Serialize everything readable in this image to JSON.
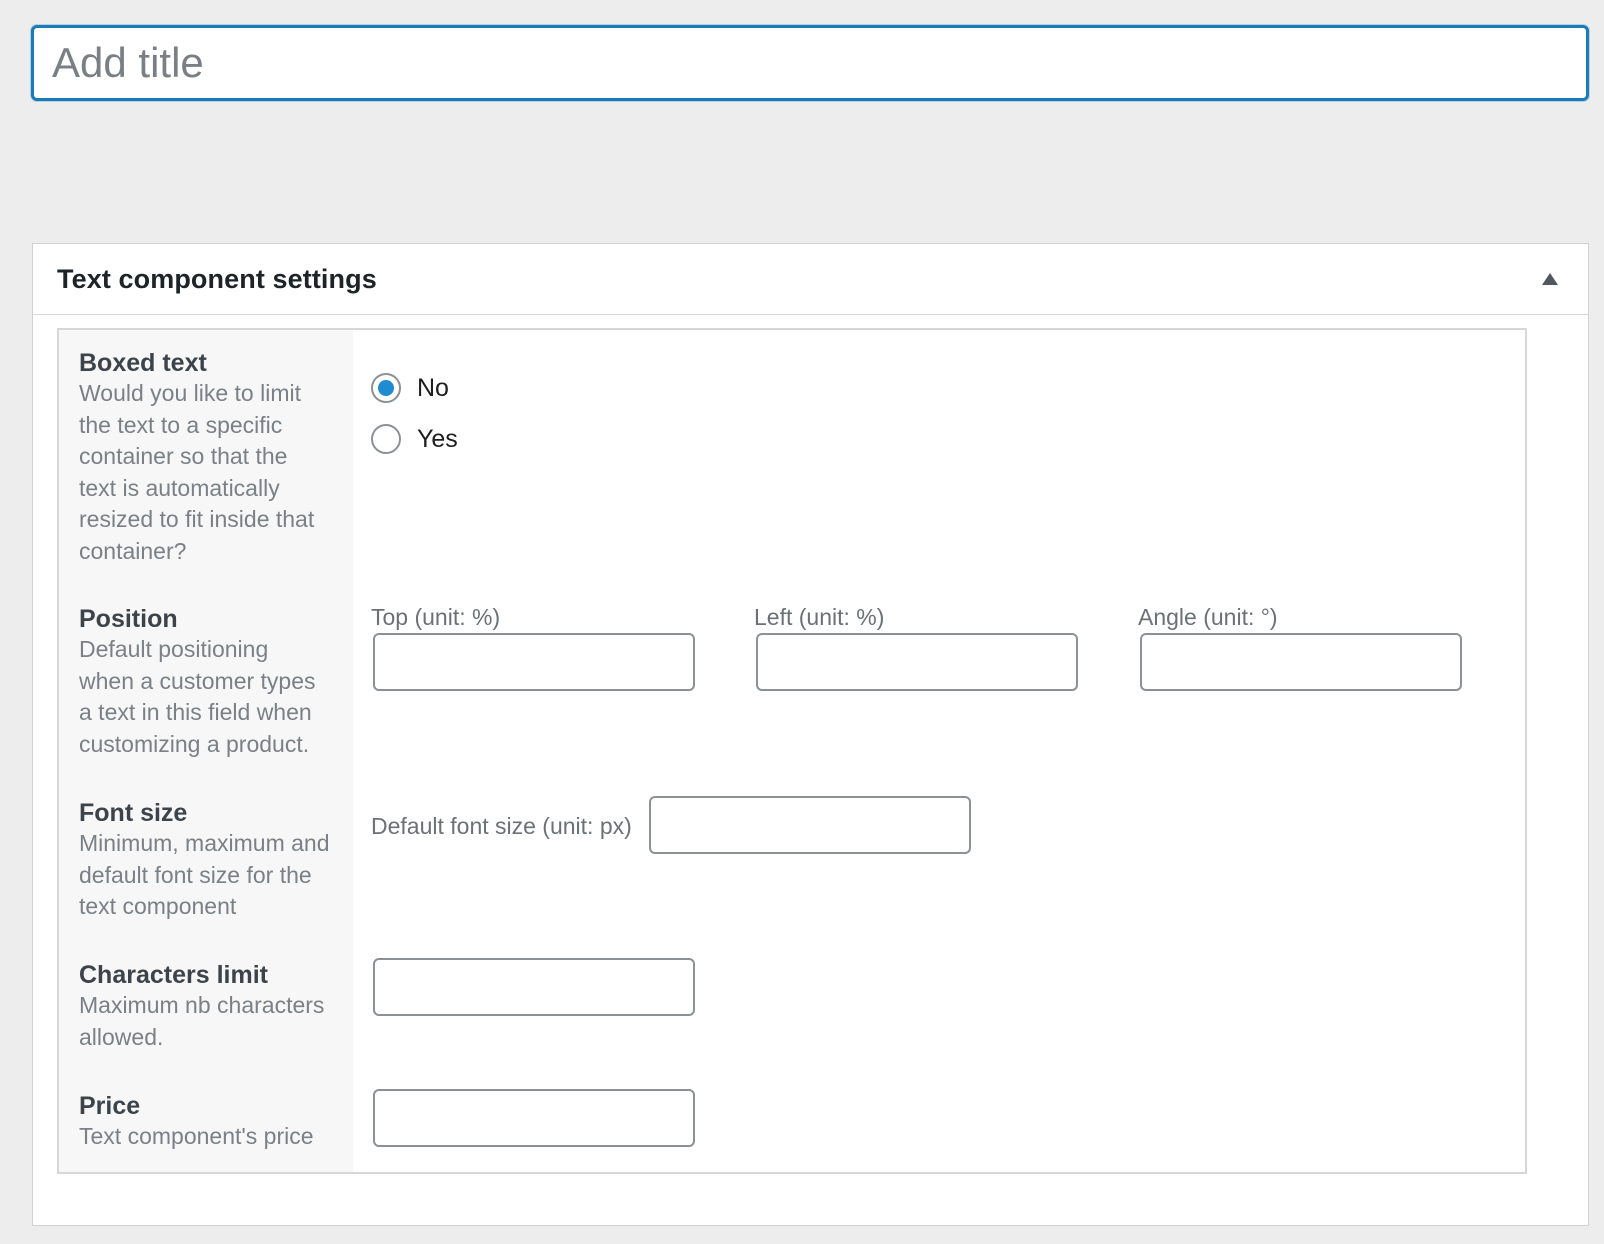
{
  "title_input": {
    "placeholder": "Add title",
    "value": ""
  },
  "metabox": {
    "title": "Text component settings",
    "collapse_icon": "triangle-up-icon",
    "rows": {
      "boxed_text": {
        "title": "Boxed text",
        "description": "Would you like to limit the text to a specific container so that the text is automatically resized to fit inside that container?",
        "options": [
          {
            "label": "No",
            "checked": true
          },
          {
            "label": "Yes",
            "checked": false
          }
        ]
      },
      "position": {
        "title": "Position",
        "description": "Default positioning when a customer types a text in this field when customizing a product.",
        "fields": [
          {
            "caption": "Top (unit: %)",
            "value": ""
          },
          {
            "caption": "Left (unit: %)",
            "value": ""
          },
          {
            "caption": "Angle (unit: °)",
            "value": ""
          }
        ]
      },
      "font_size": {
        "title": "Font size",
        "description": "Minimum, maximum and default font size for the text component",
        "field_caption": "Default font size (unit: px)",
        "value": ""
      },
      "characters_limit": {
        "title": "Characters limit",
        "description": "Maximum nb characters allowed.",
        "value": ""
      },
      "price": {
        "title": "Price",
        "description": "Text component's price",
        "value": ""
      }
    }
  },
  "colors": {
    "accent": "#1a7bb9",
    "radio_checked": "#1f8bd1",
    "background": "#ededed"
  }
}
